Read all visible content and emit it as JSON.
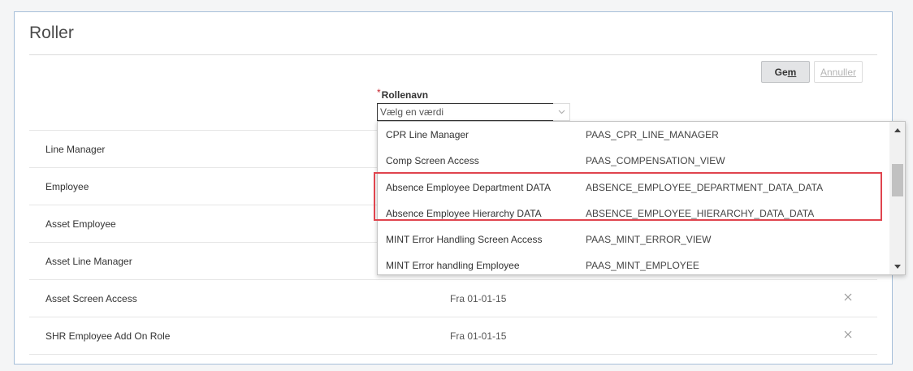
{
  "page": {
    "title": "Roller"
  },
  "toolbar": {
    "save_label_pre": "Ge",
    "save_label_ul": "m",
    "cancel_label": "Annuller"
  },
  "field": {
    "required_mark": "*",
    "label": "Rollenavn",
    "placeholder": "Vælg en værdi"
  },
  "roles": [
    {
      "name": "Line Manager",
      "date": ""
    },
    {
      "name": "Employee",
      "date": ""
    },
    {
      "name": "Asset Employee",
      "date": ""
    },
    {
      "name": "Asset Line Manager",
      "date": ""
    },
    {
      "name": "Asset Screen Access",
      "date": "Fra 01-01-15"
    },
    {
      "name": "SHR Employee Add On Role",
      "date": "Fra 01-01-15"
    }
  ],
  "dropdown": {
    "options": [
      {
        "label": "CPR Line Manager",
        "code": "PAAS_CPR_LINE_MANAGER"
      },
      {
        "label": "Comp Screen Access",
        "code": "PAAS_COMPENSATION_VIEW"
      },
      {
        "label": "Absence Employee Department DATA",
        "code": "ABSENCE_EMPLOYEE_DEPARTMENT_DATA_DATA"
      },
      {
        "label": "Absence Employee Hierarchy DATA",
        "code": "ABSENCE_EMPLOYEE_HIERARCHY_DATA_DATA"
      },
      {
        "label": "MINT Error Handling Screen Access",
        "code": "PAAS_MINT_ERROR_VIEW"
      },
      {
        "label": "MINT Error handling Employee",
        "code": "PAAS_MINT_EMPLOYEE"
      }
    ]
  },
  "colors": {
    "highlight": "#e0444e",
    "required": "#c7262e",
    "panel_border": "#a6bfd9"
  },
  "icons": {
    "delete": "close-icon",
    "combo": "chevron-down-icon",
    "scroll_up": "arrow-up-icon",
    "scroll_down": "arrow-down-icon"
  }
}
